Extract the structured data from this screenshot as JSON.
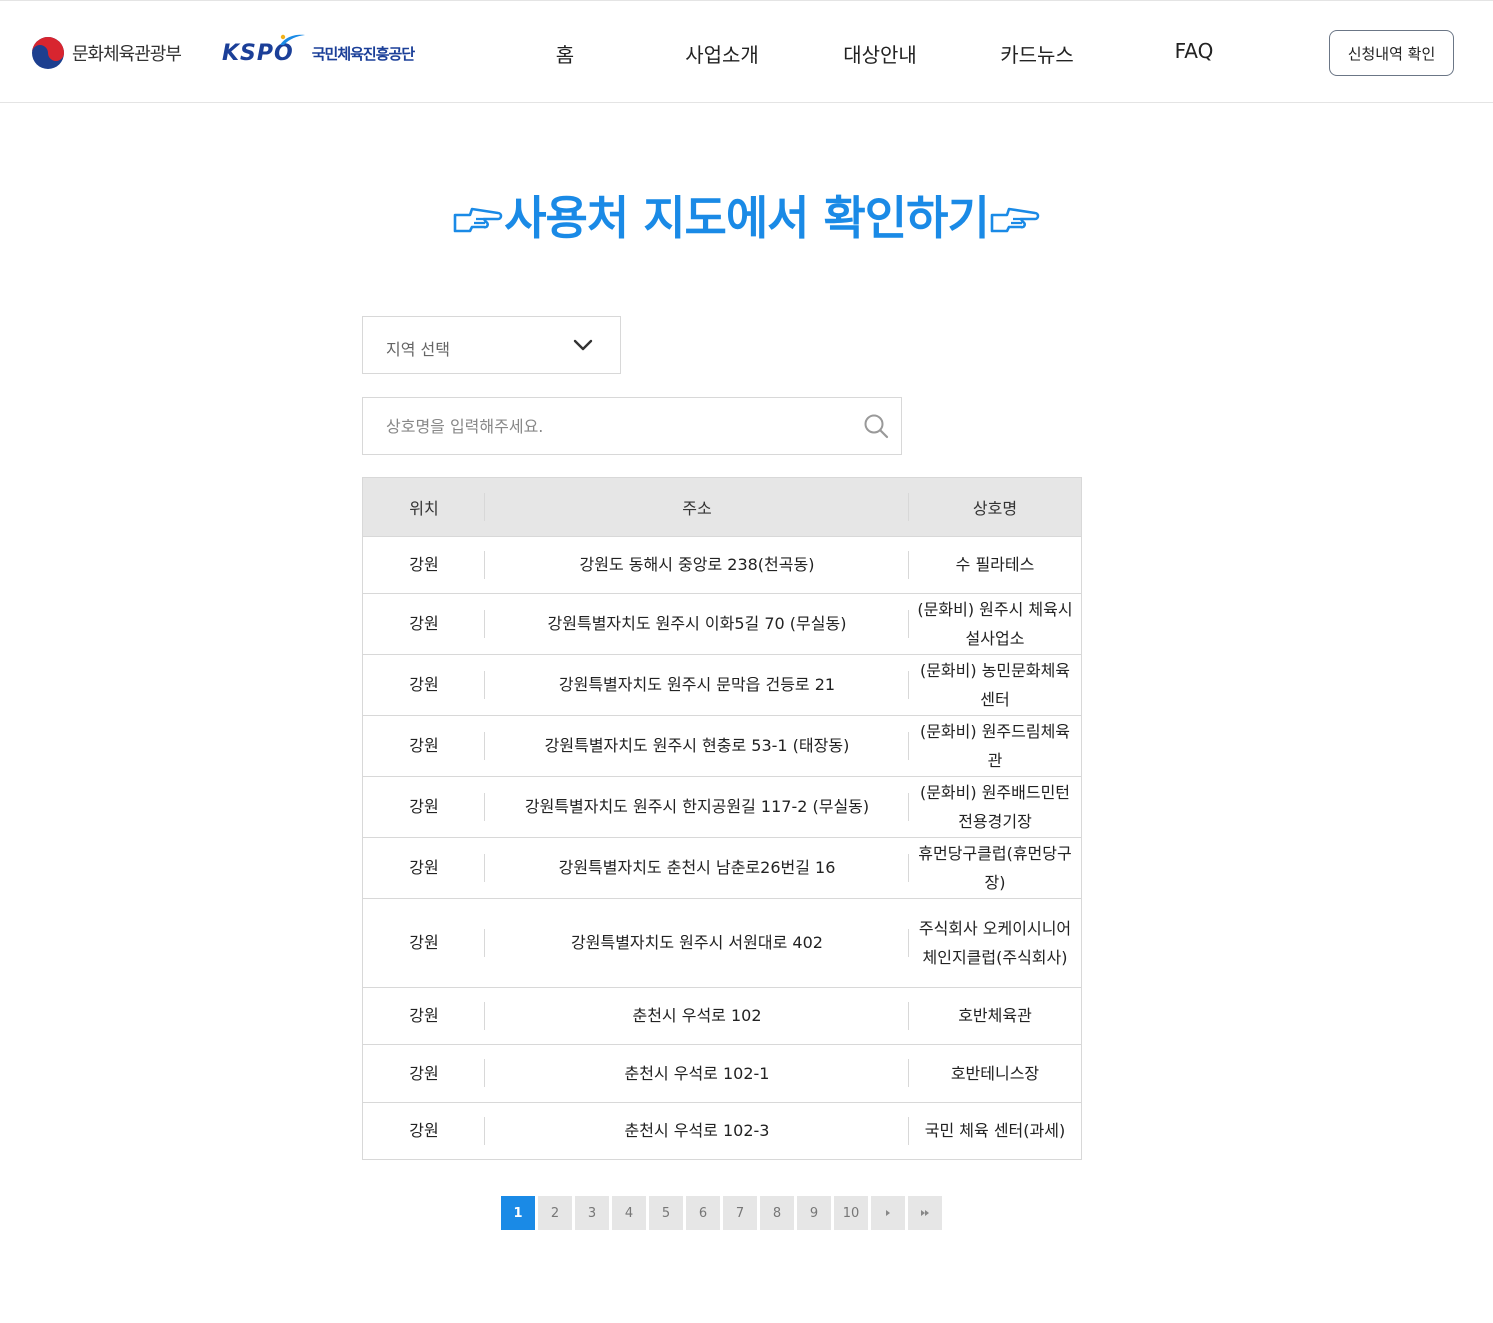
{
  "header": {
    "ministry_name": "문화체육관광부",
    "kspo_mark": "KSPO",
    "kspo_org_name": "국민체육진흥공단",
    "nav": [
      "홈",
      "사업소개",
      "대상안내",
      "카드뉴스",
      "FAQ"
    ],
    "check_button": "신청내역 확인"
  },
  "title": {
    "text": "사용처 지도에서 확인하기"
  },
  "filters": {
    "region_label": "지역 선택",
    "search_placeholder": "상호명을 입력해주세요."
  },
  "table": {
    "headers": [
      "위치",
      "주소",
      "상호명"
    ],
    "rows": [
      {
        "region": "강원",
        "address": "강원도 동해시 중앙로 238(천곡동)",
        "name": "수 필라테스"
      },
      {
        "region": "강원",
        "address": "강원특별자치도 원주시 이화5길 70 (무실동)",
        "name": "(문화비) 원주시 체육시설사업소"
      },
      {
        "region": "강원",
        "address": "강원특별자치도 원주시 문막읍 건등로 21",
        "name": "(문화비) 농민문화체육센터"
      },
      {
        "region": "강원",
        "address": "강원특별자치도 원주시 현충로 53-1 (태장동)",
        "name": "(문화비) 원주드림체육관"
      },
      {
        "region": "강원",
        "address": "강원특별자치도 원주시 한지공원길 117-2 (무실동)",
        "name": "(문화비) 원주배드민턴전용경기장"
      },
      {
        "region": "강원",
        "address": "강원특별자치도 춘천시 남춘로26번길 16",
        "name": "휴먼당구클럽(휴먼당구장)"
      },
      {
        "region": "강원",
        "address": "강원특별자치도 원주시 서원대로 402",
        "name": "주식회사 오케이시니어체인지클럽(주식회사)"
      },
      {
        "region": "강원",
        "address": "춘천시 우석로 102",
        "name": "호반체육관"
      },
      {
        "region": "강원",
        "address": "춘천시 우석로 102-1",
        "name": "호반테니스장"
      },
      {
        "region": "강원",
        "address": "춘천시 우석로 102-3",
        "name": "국민 체육 센터(과세)"
      }
    ]
  },
  "pagination": {
    "pages": [
      "1",
      "2",
      "3",
      "4",
      "5",
      "6",
      "7",
      "8",
      "9",
      "10"
    ],
    "current": "1",
    "next_icon": "caret-right-icon",
    "last_icon": "double-caret-right-icon"
  },
  "colors": {
    "accent": "#1a8ae6",
    "kspo_blue": "#1b3f98",
    "header_bg": "#e6e6e6"
  }
}
